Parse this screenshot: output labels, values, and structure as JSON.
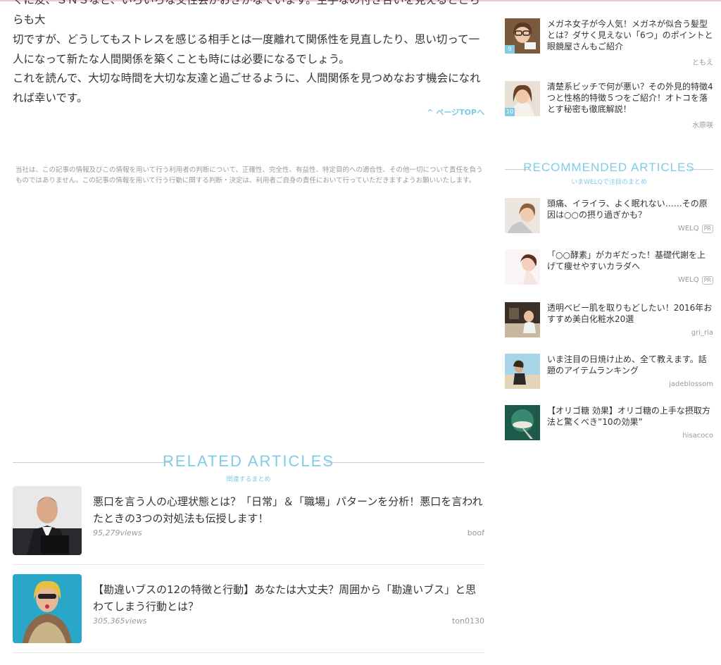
{
  "colors": {
    "accent": "#7fcce4",
    "text": "#333333",
    "muted": "#999999",
    "top_border": "#f0c8d8"
  },
  "article": {
    "cut_line": "ぐに友、ＳＮＳなど、いろいろな交性会がおきかなています。生手なの付き合いを見えるとこちらも大",
    "para1": "切ですが、どうしてもストレスを感じる相手とは一度離れて関係性を見直したり、思い切って一人になって新たな人間関係を築くことも時には必要になるでしょう。",
    "para2": "これを読んで、大切な時間を大切な友達と過ごせるように、人間関係を見つめなおす機会になれれば幸いです。",
    "page_top": "ページTOPへ",
    "disclaimer": "当社は、この記事の情報及びこの情報を用いて行う利用者の判断について、正確性、完全性、有益性、特定目的への適合性、その他一切について責任を負うものではありません。この記事の情報を用いて行う行動に関する判断・決定は、利用者ご自身の責任において行っていただきますようお願いいたします。"
  },
  "related": {
    "title": "RELATED ARTICLES",
    "subtitle": "関連するまとめ",
    "items": [
      {
        "title": "悪口を言う人の心理状態とは？「日常」＆「職場」パターンを分析！悪口を言われたときの3つの対処法も伝授します！",
        "views": "95,279views",
        "author": "boof"
      },
      {
        "title": "【勘違いブスの12の特徴と行動】あなたは大丈夫？周囲から「勘違いブス」と思わてしまう行動とは？",
        "views": "305,365views",
        "author": "ton0130"
      }
    ]
  },
  "sidebar": {
    "ranking": [
      {
        "rank": "9",
        "title": "メガネ女子が今人気！メガネが似合う髪型とは？ダサく見えない「6つ」のポイントと眼鏡屋さんもご紹介",
        "author": "ともえ"
      },
      {
        "rank": "10",
        "title": "清楚系ビッチで何が悪い？その外見的特徴4つと性格的特徴５つをご紹介！オトコを落とす秘密も徹底解説！",
        "author": "水原咲"
      }
    ],
    "recommended": {
      "title": "RECOMMENDED ARTICLES",
      "subtitle": "いまWELQで注目のまとめ",
      "items": [
        {
          "title": "頭痛、イライラ、よく眠れない……その原因は○○の摂り過ぎかも？",
          "author": "WELQ",
          "badge": "PR"
        },
        {
          "title": "「○○酵素」がカギだった！基礎代謝を上げて痩せやすいカラダへ",
          "author": "WELQ",
          "badge": "PR"
        },
        {
          "title": "透明ベビー肌を取りもどしたい！2016年おすすめ美白化粧水20選",
          "author": "gri_ria"
        },
        {
          "title": "いま注目の日焼け止め、全て教えます。話題のアイテムランキング",
          "author": "jadeblossom"
        },
        {
          "title": "【オリゴ糖 効果】オリゴ糖の上手な摂取方法と驚くべき”10の効果”",
          "author": "hisacoco"
        }
      ]
    }
  }
}
